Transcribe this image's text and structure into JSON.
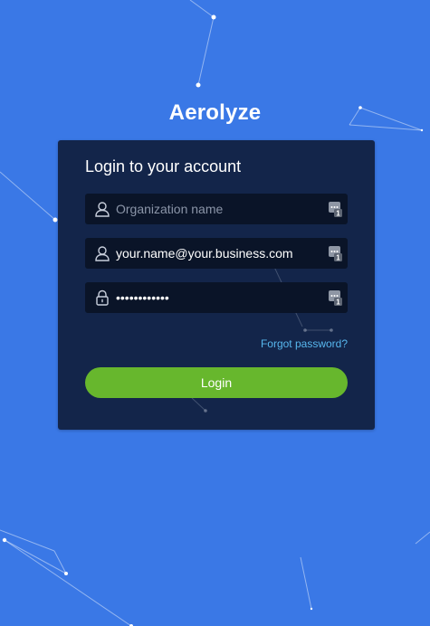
{
  "app": {
    "title": "Aerolyze"
  },
  "login": {
    "heading": "Login to your account",
    "organization": {
      "placeholder": "Organization name",
      "value": ""
    },
    "email": {
      "placeholder": "",
      "value": "your.name@your.business.com"
    },
    "password": {
      "value": "••••••••••••"
    },
    "forgot_label": "Forgot password?",
    "submit_label": "Login"
  },
  "icons": {
    "org_field": "user-icon",
    "email_field": "user-icon",
    "password_field": "lock-icon",
    "autofill": "password-manager-icon"
  },
  "colors": {
    "background": "#3a78e6",
    "card": "#13254a",
    "field": "#0a1428",
    "link": "#57b7ee",
    "button": "#67b72d"
  }
}
